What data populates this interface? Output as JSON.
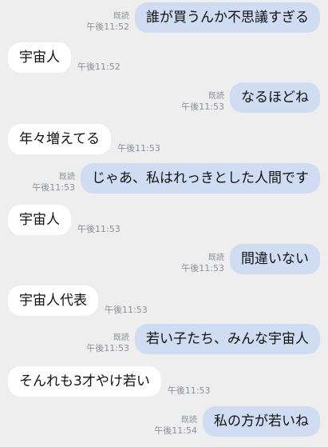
{
  "conversation": {
    "messages": [
      {
        "direction": "out",
        "text": "誰が買うんか不思議すぎる",
        "read": "既読",
        "time": "午後11:52"
      },
      {
        "direction": "in",
        "text": "宇宙人",
        "time": "午後11:52"
      },
      {
        "direction": "out",
        "text": "なるほどね",
        "read": "既読",
        "time": "午後11:53"
      },
      {
        "direction": "in",
        "text": "年々増えてる",
        "time": "午後11:53"
      },
      {
        "direction": "out",
        "text": "じゃあ、私はれっきとした人間です",
        "read": "既読",
        "time": "午後11:53"
      },
      {
        "direction": "in",
        "text": "宇宙人",
        "time": "午後11:53"
      },
      {
        "direction": "out",
        "text": "間違いない",
        "read": "既読",
        "time": "午後11:53"
      },
      {
        "direction": "in",
        "text": "宇宙人代表",
        "time": "午後11:53"
      },
      {
        "direction": "out",
        "text": "若い子たち、みんな宇宙人",
        "read": "既読",
        "time": "午後11:53"
      },
      {
        "direction": "in",
        "text": "そんれも3才やけ若い",
        "time": "午後11:53"
      },
      {
        "direction": "out",
        "text": "私の方が若いね",
        "read": "既読",
        "time": "午後11:54"
      }
    ]
  },
  "colors": {
    "background": "#eeeeee",
    "outgoing_bubble": "#cfdcf2",
    "incoming_bubble": "#ffffff",
    "meta_text": "#8a8f99"
  }
}
